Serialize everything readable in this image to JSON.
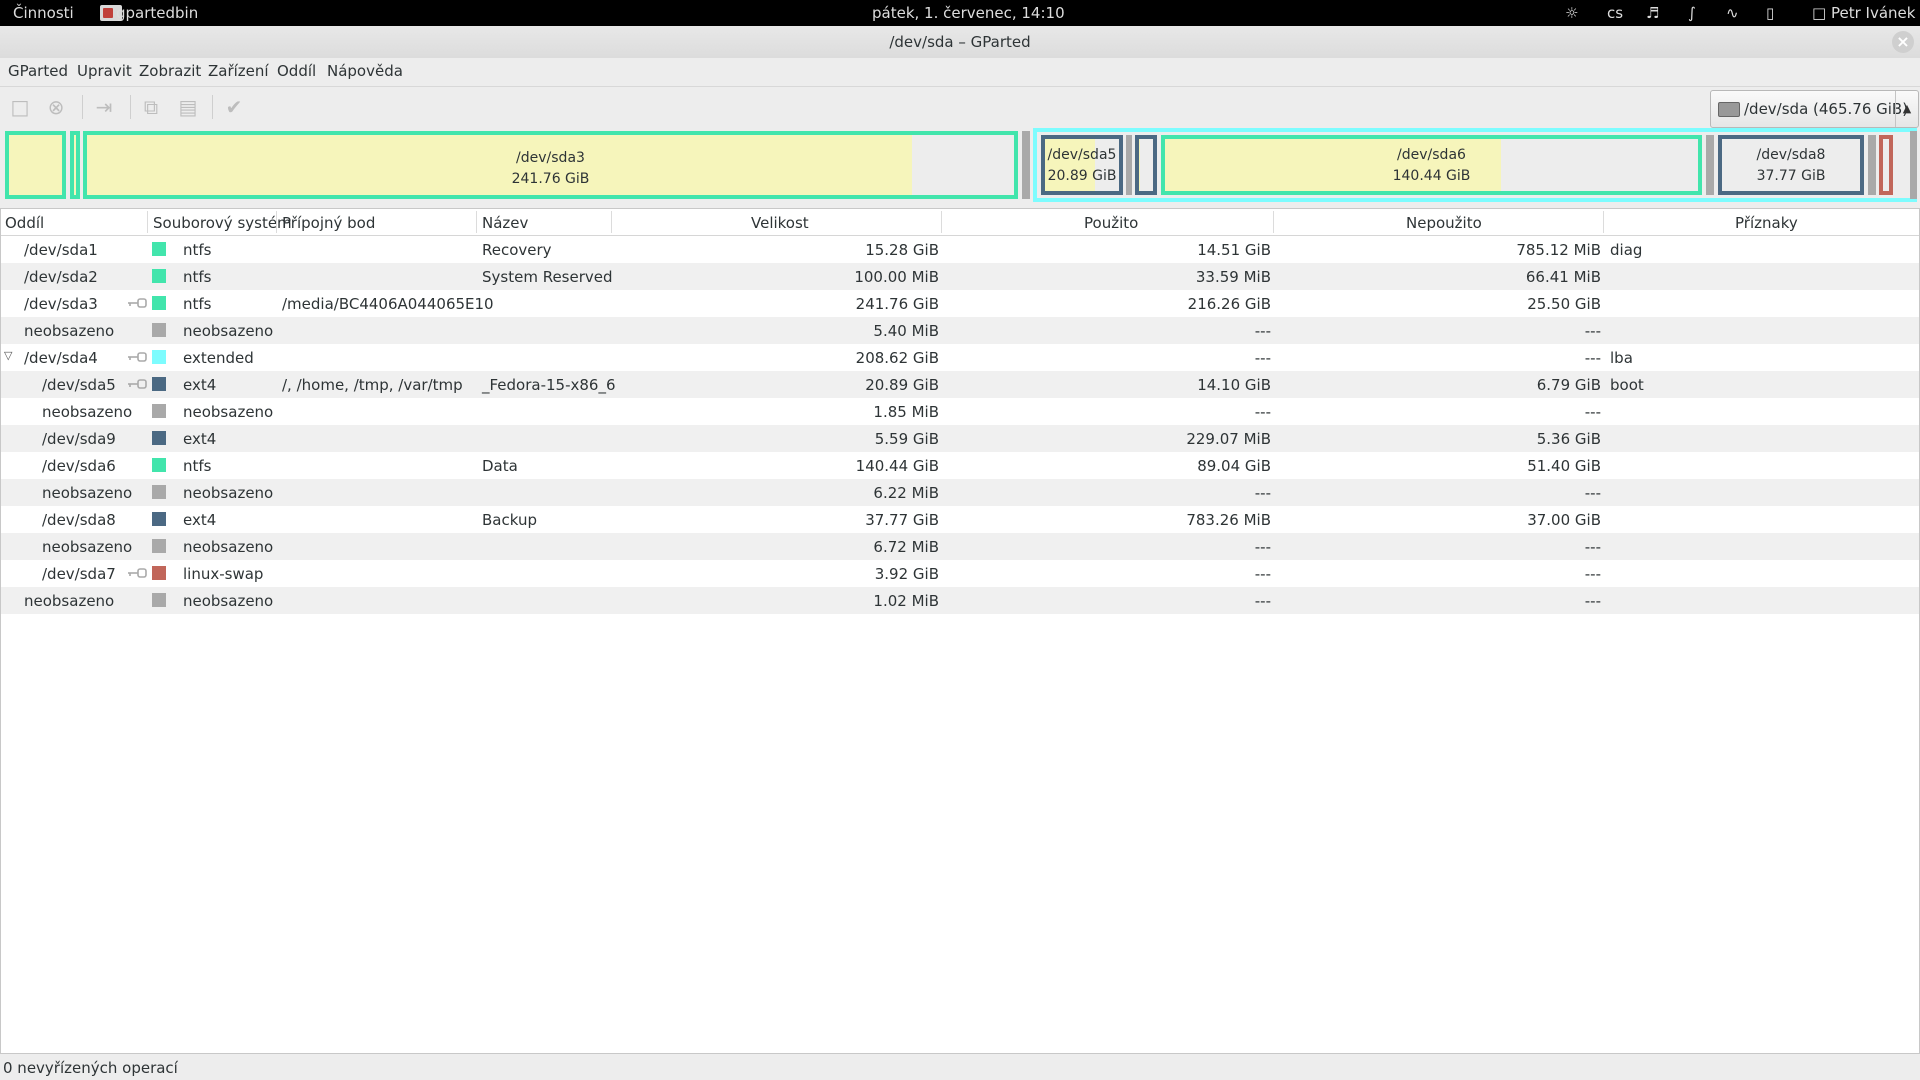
{
  "topbar": {
    "activities": "Činnosti",
    "app_name": "gpartedbin",
    "clock": "pátek,  1. červenec, 14:10",
    "lang": "cs",
    "user": "Petr Ivánek"
  },
  "window": {
    "title": "/dev/sda – GParted"
  },
  "menu": [
    "GParted",
    "Upravit",
    "Zobrazit",
    "Zařízení",
    "Oddíl",
    "Nápověda"
  ],
  "toolbar": {
    "device": "/dev/sda  (465.76 GiB)"
  },
  "colors": {
    "ntfs": "#42e5ac",
    "extended": "#7dfcfe",
    "ext4": "#4b6983",
    "linux_swap": "#c1665a",
    "unallocated": "#a9a9a9",
    "used_fill": "#f6f5bb"
  },
  "diskmap": {
    "sda3": {
      "name": "/dev/sda3",
      "size": "241.76 GiB"
    },
    "sda5": {
      "name": "/dev/sda5",
      "size": "20.89 GiB"
    },
    "sda6": {
      "name": "/dev/sda6",
      "size": "140.44 GiB"
    },
    "sda8": {
      "name": "/dev/sda8",
      "size": "37.77 GiB"
    }
  },
  "columns": [
    "Oddíl",
    "Souborový systém",
    "Přípojný bod",
    "Název",
    "Velikost",
    "Použito",
    "Nepoužito",
    "Příznaky"
  ],
  "rows": [
    {
      "partition": "/dev/sda1",
      "fs": "ntfs",
      "mount": "",
      "label": "Recovery",
      "size": "15.28 GiB",
      "used": "14.51 GiB",
      "unused": "785.12 MiB",
      "flags": "diag"
    },
    {
      "partition": "/dev/sda2",
      "fs": "ntfs",
      "mount": "",
      "label": "System Reserved",
      "size": "100.00 MiB",
      "used": "33.59 MiB",
      "unused": "66.41 MiB",
      "flags": ""
    },
    {
      "partition": "/dev/sda3",
      "fs": "ntfs",
      "mount": "/media/BC4406A044065E10",
      "label": "",
      "size": "241.76 GiB",
      "used": "216.26 GiB",
      "unused": "25.50 GiB",
      "flags": ""
    },
    {
      "partition": "neobsazeno",
      "fs": "neobsazeno",
      "mount": "",
      "label": "",
      "size": "5.40 MiB",
      "used": "---",
      "unused": "---",
      "flags": ""
    },
    {
      "partition": "/dev/sda4",
      "fs": "extended",
      "mount": "",
      "label": "",
      "size": "208.62 GiB",
      "used": "---",
      "unused": "---",
      "flags": "lba"
    },
    {
      "partition": "/dev/sda5",
      "fs": "ext4",
      "mount": "/, /home, /tmp, /var/tmp",
      "label": "_Fedora-15-x86_6",
      "size": "20.89 GiB",
      "used": "14.10 GiB",
      "unused": "6.79 GiB",
      "flags": "boot"
    },
    {
      "partition": "neobsazeno",
      "fs": "neobsazeno",
      "mount": "",
      "label": "",
      "size": "1.85 MiB",
      "used": "---",
      "unused": "---",
      "flags": ""
    },
    {
      "partition": "/dev/sda9",
      "fs": "ext4",
      "mount": "",
      "label": "",
      "size": "5.59 GiB",
      "used": "229.07 MiB",
      "unused": "5.36 GiB",
      "flags": ""
    },
    {
      "partition": "/dev/sda6",
      "fs": "ntfs",
      "mount": "",
      "label": "Data",
      "size": "140.44 GiB",
      "used": "89.04 GiB",
      "unused": "51.40 GiB",
      "flags": ""
    },
    {
      "partition": "neobsazeno",
      "fs": "neobsazeno",
      "mount": "",
      "label": "",
      "size": "6.22 MiB",
      "used": "---",
      "unused": "---",
      "flags": ""
    },
    {
      "partition": "/dev/sda8",
      "fs": "ext4",
      "mount": "",
      "label": "Backup",
      "size": "37.77 GiB",
      "used": "783.26 MiB",
      "unused": "37.00 GiB",
      "flags": ""
    },
    {
      "partition": "neobsazeno",
      "fs": "neobsazeno",
      "mount": "",
      "label": "",
      "size": "6.72 MiB",
      "used": "---",
      "unused": "---",
      "flags": ""
    },
    {
      "partition": "/dev/sda7",
      "fs": "linux-swap",
      "mount": "",
      "label": "",
      "size": "3.92 GiB",
      "used": "---",
      "unused": "---",
      "flags": ""
    },
    {
      "partition": "neobsazeno",
      "fs": "neobsazeno",
      "mount": "",
      "label": "",
      "size": "1.02 MiB",
      "used": "---",
      "unused": "---",
      "flags": ""
    }
  ],
  "status": "0 nevyřízených operací"
}
